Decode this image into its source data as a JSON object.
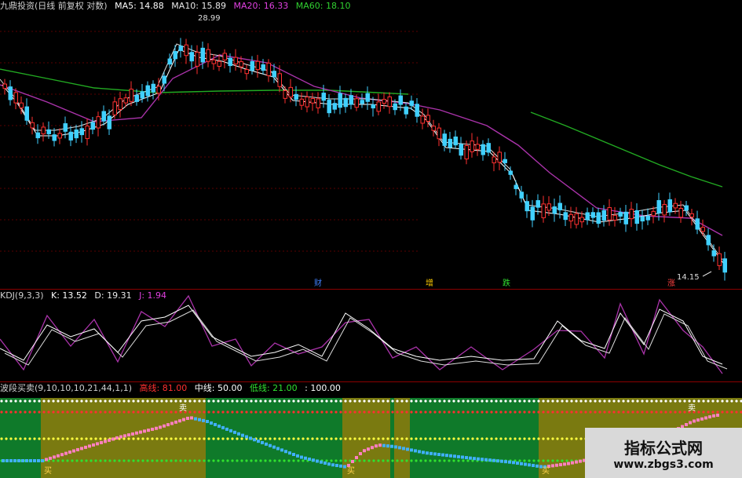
{
  "main_panel": {
    "title": "九鼎投资(日线 前复权 对数)",
    "ma5": "MA5: 14.88",
    "ma10": "MA10: 15.89",
    "ma20": "MA20: 16.33",
    "ma60": "MA60: 18.10",
    "high_price": "28.99",
    "low_price": "14.15",
    "markers": [
      "财",
      "增",
      "跌",
      "涨"
    ]
  },
  "kdj_panel": {
    "title": "KDJ(9,3,3)",
    "k": "K: 13.52",
    "d": "D: 19.31",
    "j": "J: 1.94"
  },
  "wave_panel": {
    "title": "波段买卖(9,10,10,10,21,44,1,1)",
    "high_line": "高线: 81.00",
    "mid_line": "中线: 50.00",
    "low_line": "低线: 21.00",
    "level_100": ": 100.00",
    "sell_label": "卖",
    "buy_label": "买"
  },
  "watermark": {
    "title": "指标公式网",
    "url": "www.zbgs3.com"
  },
  "colors": {
    "up": "#ff3030",
    "down": "#40d0ff",
    "ma5": "#ffffff",
    "ma10": "#e0e0e0",
    "ma20": "#cc44cc",
    "ma60": "#22aa22"
  }
}
